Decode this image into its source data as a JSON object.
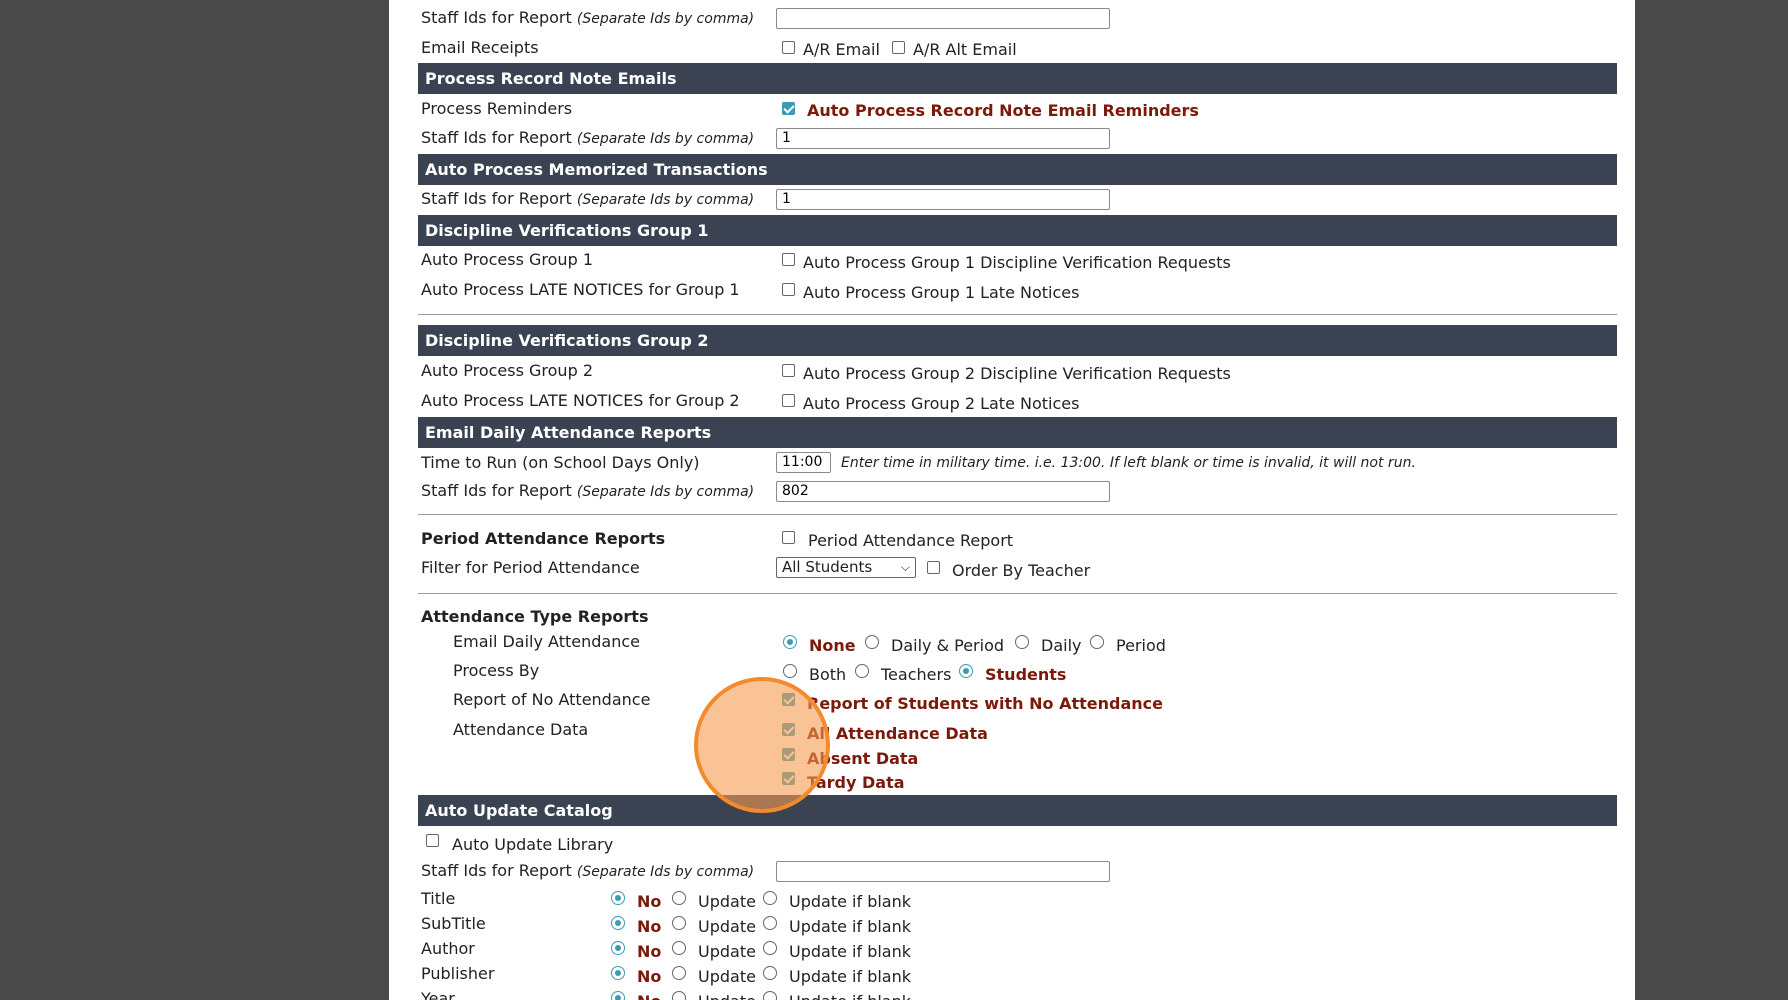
{
  "staff_ids_label": "Staff Ids for Report",
  "staff_ids_hint": "(Separate Ids by comma)",
  "email_receipts": {
    "label": "Email Receipts",
    "opt1": "A/R Email",
    "opt2": "A/R Alt Email"
  },
  "process_record_note_emails": {
    "header": "Process Record Note Emails",
    "reminders_label": "Process Reminders",
    "reminders_option": "Auto Process Record Note Email Reminders",
    "staff_ids_value": "1"
  },
  "memorized_transactions": {
    "header": "Auto Process Memorized Transactions",
    "staff_ids_value": "1"
  },
  "discipline_group1": {
    "header": "Discipline Verifications Group 1",
    "row1_label": "Auto Process Group 1",
    "row1_option": "Auto Process Group 1 Discipline Verification Requests",
    "row2_label": "Auto Process LATE NOTICES for Group 1",
    "row2_option": "Auto Process Group 1 Late Notices"
  },
  "discipline_group2": {
    "header": "Discipline Verifications Group 2",
    "row1_label": "Auto Process Group 2",
    "row1_option": "Auto Process Group 2 Discipline Verification Requests",
    "row2_label": "Auto Process LATE NOTICES for Group 2",
    "row2_option": "Auto Process Group 2 Late Notices"
  },
  "email_daily_attendance": {
    "header": "Email Daily Attendance Reports",
    "time_label": "Time to Run (on School Days Only)",
    "time_value": "11:00",
    "time_hint": "Enter time in military time. i.e. 13:00. If left blank or time is invalid, it will not run.",
    "staff_ids_value": "802"
  },
  "period_attendance": {
    "label": "Period Attendance Reports",
    "option": "Period Attendance Report",
    "filter_label": "Filter for Period Attendance",
    "filter_value": "All Students",
    "order_option": "Order By Teacher"
  },
  "attendance_type": {
    "label": "Attendance Type Reports",
    "email_daily_label": "Email Daily Attendance",
    "email_daily_options": [
      "None",
      "Daily & Period",
      "Daily",
      "Period"
    ],
    "process_by_label": "Process By",
    "process_by_options": [
      "Both",
      "Teachers",
      "Students"
    ],
    "no_attendance_label": "Report of No Attendance",
    "no_attendance_option": "Report of Students with No Attendance",
    "attendance_data_label": "Attendance Data",
    "data_options": [
      "All Attendance Data",
      "Absent Data",
      "Tardy Data"
    ]
  },
  "auto_update_catalog": {
    "header": "Auto Update Catalog",
    "library_option": "Auto Update Library",
    "staff_ids_value": "",
    "option_no": "No",
    "option_update": "Update",
    "option_update_blank": "Update if blank",
    "fields": [
      "Title",
      "SubTitle",
      "Author",
      "Publisher",
      "Year"
    ]
  },
  "colors": {
    "header_bar": "#3b4353",
    "accent": "#3a9bb5",
    "emphasis": "#7a1a0a",
    "highlight_circle": "#f28a2e"
  }
}
